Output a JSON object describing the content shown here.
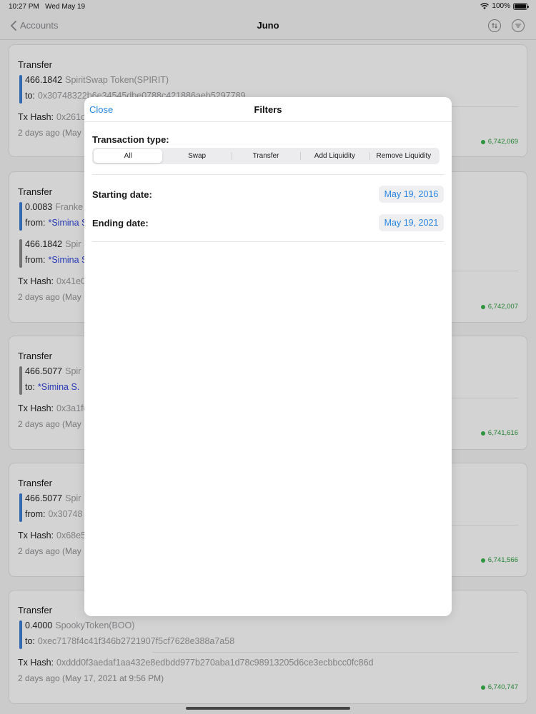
{
  "status_bar": {
    "time": "10:27 PM",
    "date": "Wed May 19",
    "battery": "100%"
  },
  "nav": {
    "back_label": "Accounts",
    "title": "Juno"
  },
  "cards": [
    {
      "kind": "Transfer",
      "entries": [
        {
          "amount": "466.1842",
          "token": "SpiritSwap Token(SPIRIT)",
          "direction": "to:",
          "party": "0x30748322b6e34545dbe0788c421886aeb5297789"
        }
      ],
      "tx_label": "Tx Hash:",
      "tx_hash": "0x261c",
      "date": "2 days ago (May 1",
      "block": "6,742,069"
    },
    {
      "kind": "Transfer",
      "entries": [
        {
          "amount": "0.0083",
          "token": "Franke",
          "direction": "from:",
          "party": "*Simina S."
        },
        {
          "amount": "466.1842",
          "token": "Spir",
          "direction": "from:",
          "party": "*Simina S."
        }
      ],
      "tx_label": "Tx Hash:",
      "tx_hash": "0x41e0",
      "date": "2 days ago (May 1",
      "block": "6,742,007"
    },
    {
      "kind": "Transfer",
      "entries": [
        {
          "amount": "466.5077",
          "token": "Spir",
          "direction": "to:",
          "party": "*Simina S."
        }
      ],
      "tx_label": "Tx Hash:",
      "tx_hash": "0x3a1fc",
      "date": "2 days ago (May 1",
      "block": "6,741,616"
    },
    {
      "kind": "Transfer",
      "entries": [
        {
          "amount": "466.5077",
          "token": "Spir",
          "direction": "from:",
          "party": "0x30748"
        }
      ],
      "tx_label": "Tx Hash:",
      "tx_hash": "0x68e5",
      "date": "2 days ago (May 1",
      "block": "6,741,566"
    },
    {
      "kind": "Transfer",
      "entries": [
        {
          "amount": "0.4000",
          "token": "SpookyToken(BOO)",
          "direction": "to:",
          "party": "0xec7178f4c41f346b2721907f5cf7628e388a7a58"
        }
      ],
      "tx_label": "Tx Hash:",
      "tx_hash": "0xddd0f3aedaf1aa432e8edbdd977b270aba1d78c98913205d6ce3ecbbcc0fc86d",
      "date": "2 days ago (May 17, 2021 at 9:56 PM)",
      "block": "6,740,747"
    }
  ],
  "filters": {
    "close_label": "Close",
    "title": "Filters",
    "transaction_type_label": "Transaction type:",
    "types": [
      "All",
      "Swap",
      "Transfer",
      "Add Liquidity",
      "Remove Liquidity"
    ],
    "selected_type": "All",
    "starting_date_label": "Starting date:",
    "starting_date": "May 19, 2016",
    "ending_date_label": "Ending date:",
    "ending_date": "May 19, 2021"
  },
  "colors": {
    "accent": "#2a86e0",
    "link": "#3045d8",
    "block_green": "#36b24a",
    "bar_blue": "#3d7ed1",
    "bar_grey": "#8b8b8b"
  },
  "icons": {
    "back": "chevron-left-icon",
    "swap": "swap-arrows-icon",
    "filter": "filter-lines-icon"
  }
}
